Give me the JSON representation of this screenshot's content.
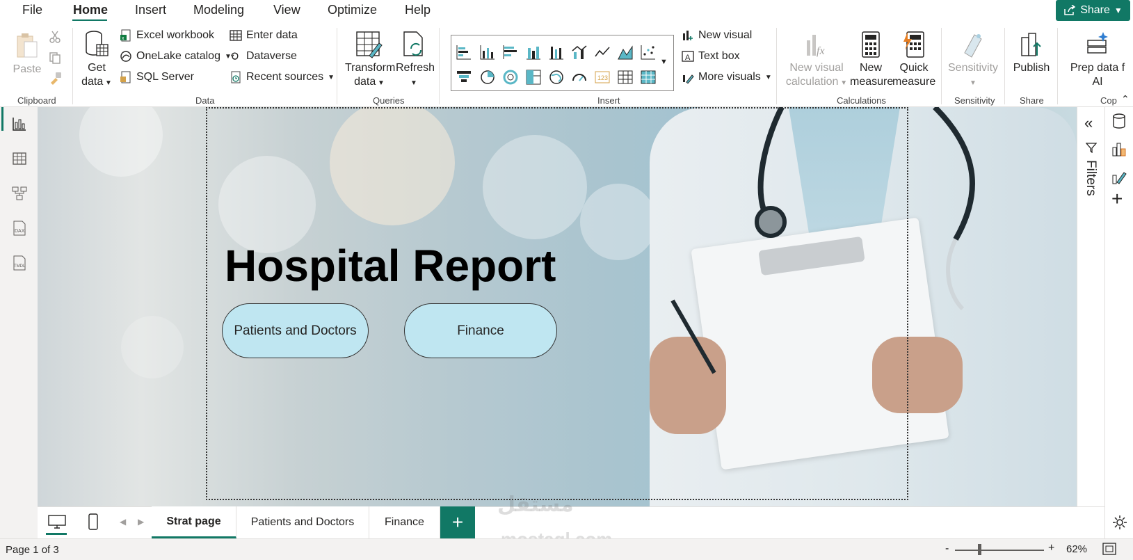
{
  "menu": {
    "items": [
      "File",
      "Home",
      "Insert",
      "Modeling",
      "View",
      "Optimize",
      "Help"
    ],
    "active": "Home",
    "share_label": "Share"
  },
  "ribbon": {
    "clipboard": {
      "label": "Clipboard",
      "paste": "Paste"
    },
    "data": {
      "label": "Data",
      "get_data": "Get",
      "get_data2": "data",
      "excel": "Excel workbook",
      "onelake": "OneLake catalog",
      "sql": "SQL Server",
      "enter_data": "Enter data",
      "dataverse": "Dataverse",
      "recent": "Recent sources"
    },
    "queries": {
      "label": "Queries",
      "transform": "Transform",
      "transform2": "data",
      "refresh": "Refresh"
    },
    "insert": {
      "label": "Insert",
      "new_visual": "New visual",
      "text_box": "Text box",
      "more_visuals": "More visuals"
    },
    "calculations": {
      "label": "Calculations",
      "new_visual_calc": "New visual",
      "new_visual_calc2": "calculation",
      "new_measure": "New",
      "new_measure2": "measure",
      "quick_measure": "Quick",
      "quick_measure2": "measure"
    },
    "sensitivity": {
      "label": "Sensitivity",
      "btn": "Sensitivity"
    },
    "share": {
      "label": "Share",
      "publish": "Publish"
    },
    "copilot": {
      "label": "Cop",
      "prep": "Prep data f",
      "prep2": "AI"
    }
  },
  "canvas": {
    "title": "Hospital Report",
    "buttons": [
      "Patients and Doctors",
      "Finance"
    ]
  },
  "filters": {
    "label": "Filters"
  },
  "tabs": {
    "pages": [
      "Strat page",
      "Patients and Doctors",
      "Finance"
    ],
    "active": "Strat page",
    "add": "+"
  },
  "status": {
    "page_info": "Page 1 of 3",
    "zoom": "62%",
    "zoom_percent": 62
  },
  "watermark": {
    "line1": "مستقل",
    "line2": "mostaql.com"
  },
  "colors": {
    "accent": "#117865",
    "button_fill": "#bfe6f1"
  }
}
